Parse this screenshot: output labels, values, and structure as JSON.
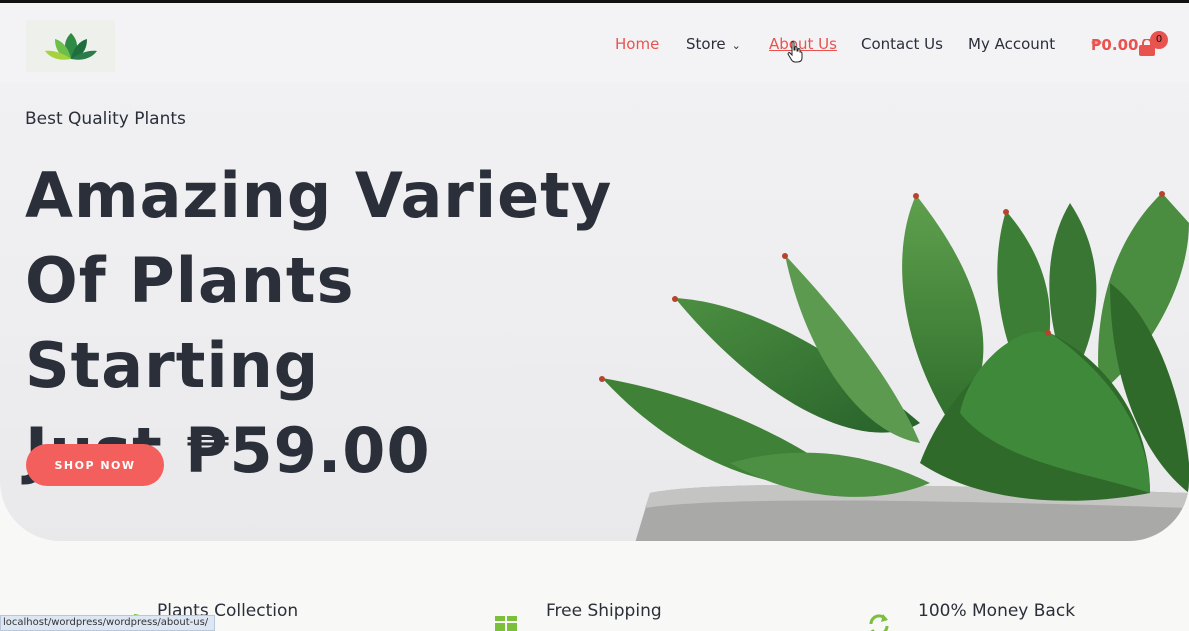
{
  "header": {
    "nav": {
      "home": "Home",
      "store": "Store",
      "about": "About Us",
      "contact": "Contact Us",
      "account": "My Account"
    },
    "cart_total": "₱0.00",
    "cart_count": "0"
  },
  "hero": {
    "tagline": "Best Quality Plants",
    "headline_line1": "Amazing Variety",
    "headline_line2": "Of Plants Starting",
    "headline_line3": "Just ₱59.00",
    "cta": "SHOP NOW"
  },
  "features": [
    {
      "title": "Plants Collection",
      "icon": "plant-icon"
    },
    {
      "title": "Free Shipping",
      "icon": "box-icon"
    },
    {
      "title": "100% Money Back",
      "icon": "refresh-icon"
    }
  ],
  "status_bar": {
    "url": "localhost/wordpress/wordpress/about-us/"
  },
  "colors": {
    "accent": "#e9534f",
    "button": "#f25f5c",
    "text": "#2b2f3a",
    "plant_green": "#3f8a3a"
  }
}
